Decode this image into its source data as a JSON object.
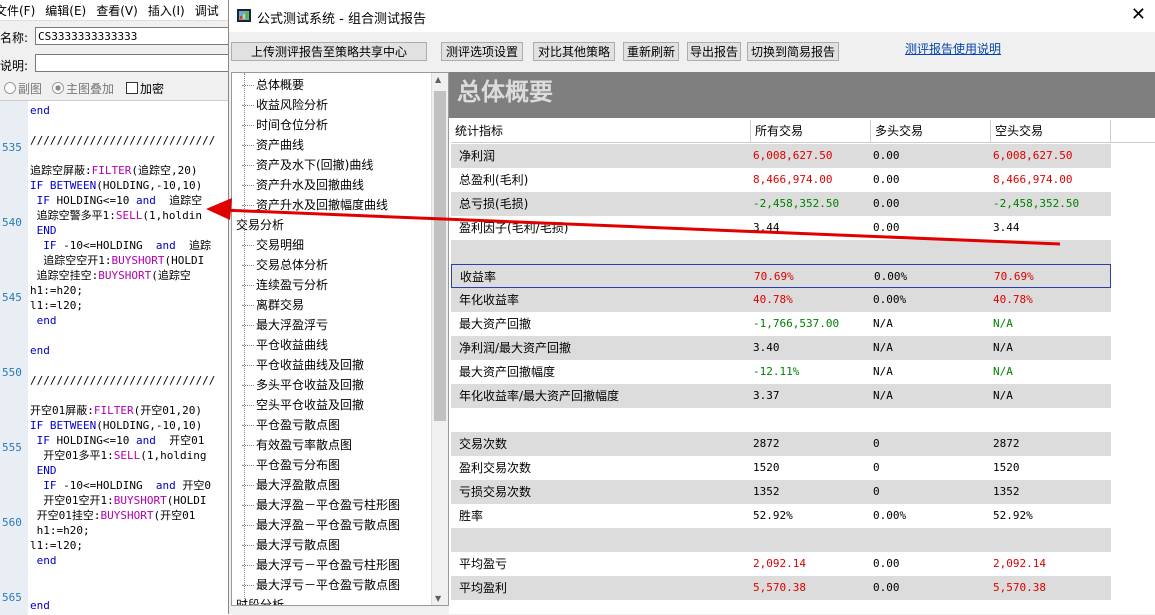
{
  "editor": {
    "menu": [
      "文件(F)",
      "编辑(E)",
      "查看(V)",
      "插入(I)",
      "调试"
    ],
    "name_label": "名称:",
    "name_value": "CS3333333333333",
    "desc_label": "说明:",
    "desc_value": "",
    "radio_sub": "副图",
    "radio_main": "主图叠加",
    "check_encrypt": "加密",
    "line_numbers": [
      "535",
      "540",
      "545",
      "550",
      "555",
      "560",
      "565"
    ],
    "code": [
      "end",
      "",
      "////////////////////////////",
      "",
      "追踪空屏蔽:FILTER(追踪空,20)",
      "IF BETWEEN(HOLDING,-10,10)",
      " IF HOLDING<=10 and  追踪空",
      " 追踪空警多平1:SELL(1,holdin",
      " END",
      "  IF -10<=HOLDING  and  追踪",
      "  追踪空空开1:BUYSHORT(HOLDI",
      " 追踪空挂空:BUYSHORT(追踪空",
      "h1:=h20;",
      "l1:=l20;",
      " end",
      "",
      "end",
      "",
      "////////////////////////////",
      "",
      "开空01屏蔽:FILTER(开空01,20)",
      "IF BETWEEN(HOLDING,-10,10)",
      " IF HOLDING<=10 and  开空01",
      "  开空01多平1:SELL(1,holding",
      " END",
      "  IF -10<=HOLDING  and 开空0",
      "  开空01空开1:BUYSHORT(HOLDI",
      " 开空01挂空:BUYSHORT(开空01",
      " h1:=h20;",
      "l1:=l20;",
      " end",
      "",
      "",
      "end"
    ]
  },
  "window": {
    "title": "公式测试系统 - 组合测试报告",
    "close": "✕",
    "toolbar": {
      "upload": "上传测评报告至策略共享中心",
      "options": "测评选项设置",
      "compare": "对比其他策略",
      "refresh": "重新刷新",
      "export": "导出报告",
      "simple": "切换到简易报告",
      "help": "测评报告使用说明"
    }
  },
  "tree": {
    "items": [
      {
        "label": "总体概要",
        "level": 1
      },
      {
        "label": "收益风险分析",
        "level": 1
      },
      {
        "label": "时间仓位分析",
        "level": 1
      },
      {
        "label": "资产曲线",
        "level": 1
      },
      {
        "label": "资产及水下(回撤)曲线",
        "level": 1
      },
      {
        "label": "资产升水及回撤曲线",
        "level": 1
      },
      {
        "label": "资产升水及回撤幅度曲线",
        "level": 1
      },
      {
        "label": "交易分析",
        "level": 0
      },
      {
        "label": "交易明细",
        "level": 1
      },
      {
        "label": "交易总体分析",
        "level": 1
      },
      {
        "label": "连续盈亏分析",
        "level": 1
      },
      {
        "label": "离群交易",
        "level": 1
      },
      {
        "label": "最大浮盈浮亏",
        "level": 1
      },
      {
        "label": "平仓收益曲线",
        "level": 1
      },
      {
        "label": "平仓收益曲线及回撤",
        "level": 1
      },
      {
        "label": "多头平仓收益及回撤",
        "level": 1
      },
      {
        "label": "空头平仓收益及回撤",
        "level": 1
      },
      {
        "label": "平仓盈亏散点图",
        "level": 1
      },
      {
        "label": "有效盈亏率散点图",
        "level": 1
      },
      {
        "label": "平仓盈亏分布图",
        "level": 1
      },
      {
        "label": "最大浮盈散点图",
        "level": 1
      },
      {
        "label": "最大浮盈－平仓盈亏柱形图",
        "level": 1
      },
      {
        "label": "最大浮盈－平仓盈亏散点图",
        "level": 1
      },
      {
        "label": "最大浮亏散点图",
        "level": 1
      },
      {
        "label": "最大浮亏－平仓盈亏柱形图",
        "level": 1
      },
      {
        "label": "最大浮亏－平仓盈亏散点图",
        "level": 1
      },
      {
        "label": "时段分析",
        "level": 0
      }
    ],
    "scroll_up": "▲",
    "scroll_down": "▼"
  },
  "report": {
    "title": "总体概要",
    "headers": [
      "统计指标",
      "所有交易",
      "多头交易",
      "空头交易"
    ],
    "rows": [
      {
        "label": "净利润",
        "all": "6,008,627.50",
        "long": "0.00",
        "short": "6,008,627.50",
        "color": "red"
      },
      {
        "label": "总盈利(毛利)",
        "all": "8,466,974.00",
        "long": "0.00",
        "short": "8,466,974.00",
        "color": "red"
      },
      {
        "label": "总亏损(毛损)",
        "all": "-2,458,352.50",
        "long": "0.00",
        "short": "-2,458,352.50",
        "color": "grn"
      },
      {
        "label": "盈利因子(毛利/毛损)",
        "all": "3.44",
        "long": "0.00",
        "short": "3.44",
        "color": ""
      },
      {
        "label": "",
        "all": "",
        "long": "",
        "short": "",
        "color": ""
      },
      {
        "label": "收益率",
        "all": "70.69%",
        "long": "0.00%",
        "short": "70.69%",
        "color": "red"
      },
      {
        "label": "年化收益率",
        "all": "40.78%",
        "long": "0.00%",
        "short": "40.78%",
        "color": "red"
      },
      {
        "label": "最大资产回撤",
        "all": "-1,766,537.00",
        "long": "N/A",
        "short": "N/A",
        "color": "grn"
      },
      {
        "label": "净利润/最大资产回撤",
        "all": "3.40",
        "long": "N/A",
        "short": "N/A",
        "color": ""
      },
      {
        "label": "最大资产回撤幅度",
        "all": "-12.11%",
        "long": "N/A",
        "short": "N/A",
        "color": "grn"
      },
      {
        "label": "年化收益率/最大资产回撤幅度",
        "all": "3.37",
        "long": "N/A",
        "short": "N/A",
        "color": ""
      },
      {
        "label": "",
        "all": "",
        "long": "",
        "short": "",
        "color": ""
      },
      {
        "label": "交易次数",
        "all": "2872",
        "long": "0",
        "short": "2872",
        "color": ""
      },
      {
        "label": "盈利交易次数",
        "all": "1520",
        "long": "0",
        "short": "1520",
        "color": ""
      },
      {
        "label": "亏损交易次数",
        "all": "1352",
        "long": "0",
        "short": "1352",
        "color": ""
      },
      {
        "label": "胜率",
        "all": "52.92%",
        "long": "0.00%",
        "short": "52.92%",
        "color": ""
      },
      {
        "label": "",
        "all": "",
        "long": "",
        "short": "",
        "color": ""
      },
      {
        "label": "平均盈亏",
        "all": "2,092.14",
        "long": "0.00",
        "short": "2,092.14",
        "color": "red"
      },
      {
        "label": "平均盈利",
        "all": "5,570.38",
        "long": "0.00",
        "short": "5,570.38",
        "color": "red"
      }
    ]
  },
  "colors": {
    "positive": "#e00000",
    "negative": "#008000",
    "arrow": "#e00000",
    "title_band": "#7f7f7f"
  }
}
